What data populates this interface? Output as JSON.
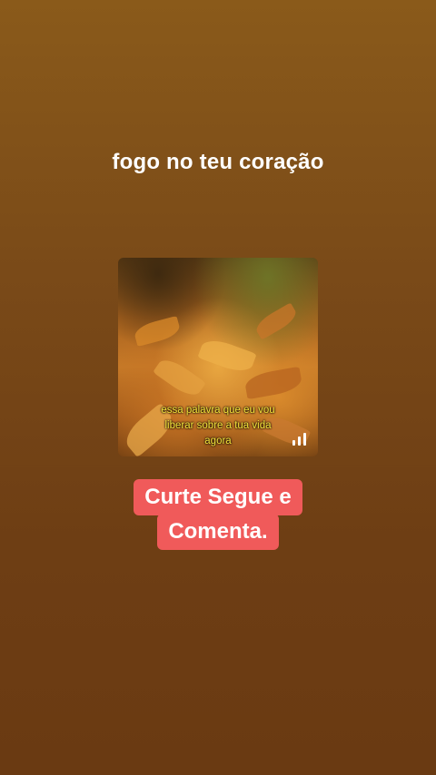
{
  "story": {
    "headline": "fogo no teu coração",
    "media": {
      "caption_line1": "essa palavra que eu vou",
      "caption_line2": "liberar sobre a tua vida",
      "caption_line3": "agora",
      "audio_icon": "audio-bars-icon"
    },
    "cta": {
      "line1": "Curte Segue e",
      "line2": "Comenta."
    }
  },
  "colors": {
    "background_top": "#8a5a1a",
    "background_bottom": "#6a3a12",
    "cta_background": "#f05a5a",
    "caption_text": "#f4e23a",
    "headline_text": "#ffffff"
  }
}
